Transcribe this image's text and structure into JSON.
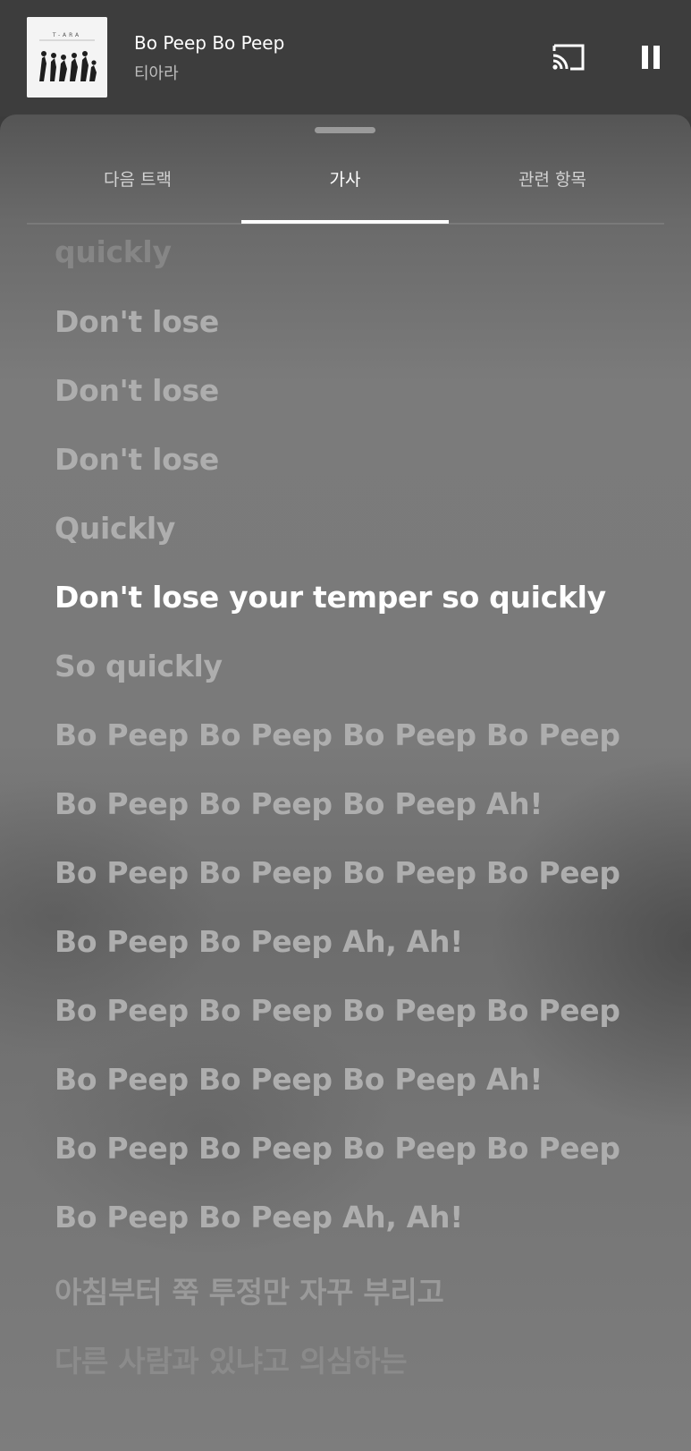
{
  "mini_player": {
    "title": "Bo Peep Bo Peep",
    "artist": "티아라",
    "album_art_text": "T-ARA",
    "icons": {
      "cast": "cast-icon",
      "pause": "pause-icon"
    }
  },
  "tabs": [
    {
      "label": "다음 트랙",
      "active": false
    },
    {
      "label": "가사",
      "active": true
    },
    {
      "label": "관련 항목",
      "active": false
    }
  ],
  "lyrics": {
    "current_index": 5,
    "lines": [
      "quickly",
      "Don't lose",
      "Don't lose",
      "Don't lose",
      "Quickly",
      "Don't lose your temper so quickly",
      "So quickly",
      "Bo Peep Bo Peep Bo Peep Bo Peep",
      "Bo Peep Bo Peep Bo Peep Ah!",
      "Bo Peep Bo Peep Bo Peep Bo Peep",
      "Bo Peep Bo Peep Ah, Ah!",
      "Bo Peep Bo Peep Bo Peep Bo Peep",
      "Bo Peep Bo Peep Bo Peep Ah!",
      "Bo Peep Bo Peep Bo Peep Bo Peep",
      "Bo Peep Bo Peep Ah, Ah!",
      "아침부터 쭉 투정만 자꾸 부리고",
      "다른 사람과 있냐고 의심하는"
    ]
  },
  "colors": {
    "header_bg": "#3d3d3d",
    "active_text": "#ffffff",
    "inactive_lyric": "#aeaeae"
  }
}
